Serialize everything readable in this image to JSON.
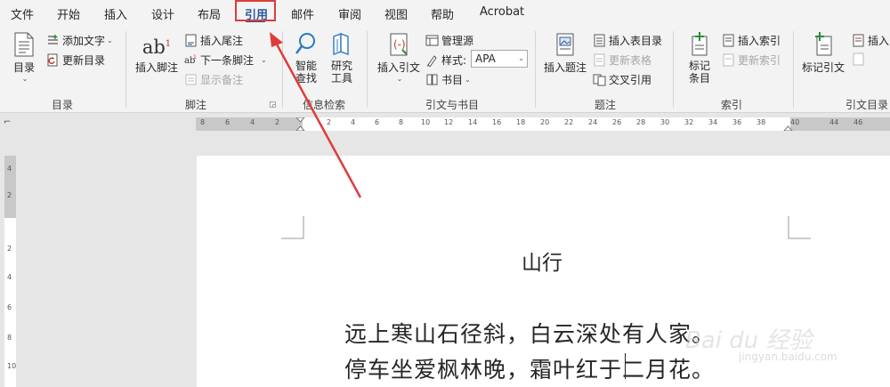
{
  "tabs": [
    "文件",
    "开始",
    "插入",
    "设计",
    "布局",
    "引用",
    "邮件",
    "审阅",
    "视图",
    "帮助",
    "Acrobat"
  ],
  "active_tab": "引用",
  "ribbon": {
    "toc": {
      "big_label": "目录",
      "add_text": "添加文字",
      "update_toc": "更新目录",
      "group_label": "目录"
    },
    "footnotes": {
      "ab_glyph": "ab",
      "sup_glyph": "1",
      "insert_footnote": "插入脚注",
      "insert_endnote": "插入尾注",
      "next_footnote": "下一条脚注",
      "show_notes": "显示备注",
      "group_label": "脚注"
    },
    "research": {
      "smart_lookup_1": "智能",
      "smart_lookup_2": "查找",
      "researcher_1": "研究",
      "researcher_2": "工具",
      "group_label": "信息检索"
    },
    "citations": {
      "insert_citation": "插入引文",
      "manage_sources": "管理源",
      "style_label": "样式:",
      "style_value": "APA",
      "bibliography": "书目",
      "group_label": "引文与书目"
    },
    "captions": {
      "insert_caption": "插入题注",
      "insert_table_of_figures": "插入表目录",
      "update_table": "更新表格",
      "cross_reference": "交叉引用",
      "group_label": "题注"
    },
    "index": {
      "mark_entry_1": "标记",
      "mark_entry_2": "条目",
      "insert_index": "插入索引",
      "update_index": "更新索引",
      "group_label": "索引"
    },
    "toa": {
      "mark_citation": "标记引文",
      "insert_toa": "插入引",
      "group_label": "引文目录"
    }
  },
  "ruler": {
    "h_numbers": [
      "8",
      "6",
      "4",
      "2",
      "2",
      "4",
      "6",
      "8",
      "10",
      "12",
      "14",
      "16",
      "18",
      "20",
      "22",
      "24",
      "26",
      "28",
      "30",
      "32",
      "34",
      "36",
      "38",
      "40",
      "44",
      "46"
    ],
    "v_numbers": [
      "4",
      "2",
      "2",
      "4",
      "6",
      "8",
      "10"
    ]
  },
  "document": {
    "title": "山行",
    "line1": "远上寒山石径斜，白云深处有人家。",
    "line2": "停车坐爱枫林晚，霜叶红于二月花。"
  },
  "watermark": {
    "main": "Bai du 经验",
    "sub": "jingyan.baidu.com"
  },
  "colors": {
    "accent": "#2b579a",
    "highlight": "#e03b3b",
    "arrow": "#e03b3b"
  }
}
